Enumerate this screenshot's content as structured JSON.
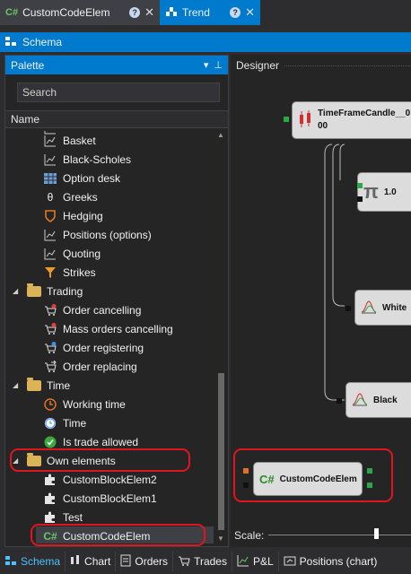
{
  "doc_tabs": [
    {
      "icon": "C#",
      "label": "CustomCodeElem",
      "active": false
    },
    {
      "icon": "chart",
      "label": "Trend",
      "active": true
    }
  ],
  "schema_title": "Schema",
  "palette": {
    "title": "Palette",
    "search_placeholder": "Search",
    "column_header": "Name",
    "items": [
      {
        "label": "Basket",
        "icon": "line-chart-icon"
      },
      {
        "label": "Black-Scholes",
        "icon": "line-chart-icon"
      },
      {
        "label": "Option desk",
        "icon": "table-icon"
      },
      {
        "label": "Greeks",
        "icon": "theta-icon"
      },
      {
        "label": "Hedging",
        "icon": "shield-icon"
      },
      {
        "label": "Positions (options)",
        "icon": "line-chart-icon"
      },
      {
        "label": "Quoting",
        "icon": "line-chart-icon"
      },
      {
        "label": "Strikes",
        "icon": "funnel-icon"
      },
      {
        "label": "Trading",
        "icon": "folder-icon"
      },
      {
        "label": "Order cancelling",
        "icon": "cart-cancel-icon"
      },
      {
        "label": "Mass orders cancelling",
        "icon": "cart-cancel-icon"
      },
      {
        "label": "Order registering",
        "icon": "cart-add-icon"
      },
      {
        "label": "Order replacing",
        "icon": "cart-replace-icon"
      },
      {
        "label": "Time",
        "icon": "folder-icon"
      },
      {
        "label": "Working time",
        "icon": "clock-icon"
      },
      {
        "label": "Time",
        "icon": "clock-icon"
      },
      {
        "label": "Is trade allowed",
        "icon": "check-icon"
      },
      {
        "label": "Own elements",
        "icon": "folder-icon"
      },
      {
        "label": "CustomBlockElem2",
        "icon": "puzzle-icon"
      },
      {
        "label": "CustomBlockElem1",
        "icon": "puzzle-icon"
      },
      {
        "label": "Test",
        "icon": "puzzle-icon"
      },
      {
        "label": "CustomCodeElem",
        "icon": "csharp-icon"
      }
    ]
  },
  "designer": {
    "title": "Designer",
    "nodes": [
      {
        "label_line1": "TimeFrameCandle__0",
        "label_line2": "00"
      },
      {
        "label": "1.0"
      },
      {
        "label": "White"
      },
      {
        "label": "Black"
      },
      {
        "label": "CustomCodeElem"
      }
    ],
    "scale_label": "Scale:"
  },
  "bottom_tabs": [
    "Schema",
    "Chart",
    "Orders",
    "Trades",
    "P&L",
    "Positions (chart)"
  ],
  "colors": {
    "accent": "#007acc",
    "highlight": "#e0151d"
  }
}
